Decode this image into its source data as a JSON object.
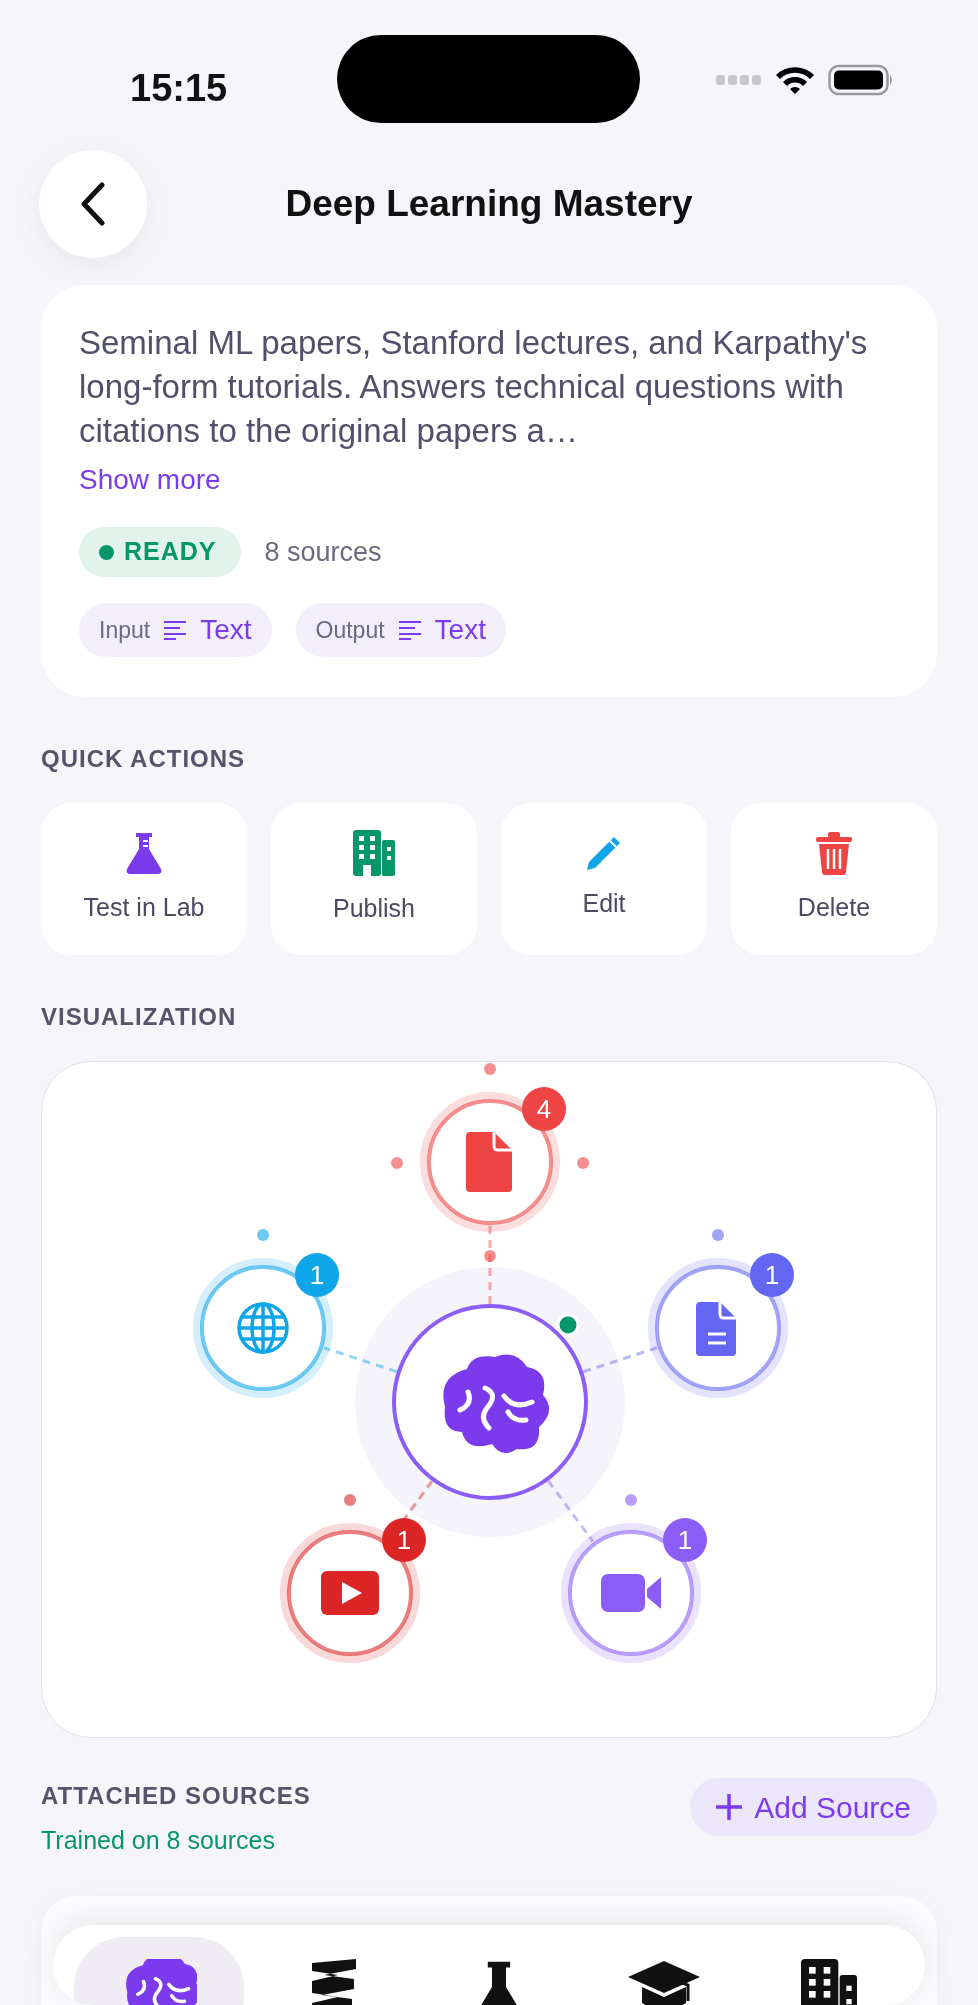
{
  "status_bar": {
    "time": "15:15"
  },
  "header": {
    "title": "Deep Learning Mastery"
  },
  "summary": {
    "description": "Seminal ML papers, Stanford lectures, and Karpathy's long-form tutorials. Answers technical questions with citations to the original papers a…",
    "show_more": "Show more",
    "status": {
      "label": "READY",
      "color": "#059669"
    },
    "source_count": "8 sources",
    "io": [
      {
        "label": "Input",
        "value": "Text"
      },
      {
        "label": "Output",
        "value": "Text"
      }
    ]
  },
  "quick_actions": {
    "title": "QUICK ACTIONS",
    "actions": [
      {
        "kind": "lab",
        "label": "Test in Lab",
        "color": "#7c3aed"
      },
      {
        "kind": "publish",
        "label": "Publish",
        "color": "#059669"
      },
      {
        "kind": "edit",
        "label": "Edit",
        "color": "#0ea5e9"
      },
      {
        "kind": "delete",
        "label": "Delete",
        "color": "#ef4444"
      }
    ]
  },
  "visualization": {
    "title": "VISUALIZATION",
    "nodes": [
      {
        "kind": "pdf",
        "count": "4",
        "color": "#ef4444"
      },
      {
        "kind": "web",
        "count": "1",
        "color": "#0ea5e9"
      },
      {
        "kind": "doc",
        "count": "1",
        "color": "#6366f1"
      },
      {
        "kind": "youtube",
        "count": "1",
        "color": "#dc2626"
      },
      {
        "kind": "video",
        "count": "1",
        "color": "#8b5cf6"
      }
    ]
  },
  "attached_sources": {
    "title": "ATTACHED SOURCES",
    "subtitle": "Trained on 8 sources",
    "add_button": "Add Source"
  },
  "tab_bar": [
    {
      "kind": "brain",
      "selected": true
    },
    {
      "kind": "layers",
      "selected": false
    },
    {
      "kind": "lab",
      "selected": false
    },
    {
      "kind": "academy",
      "selected": false
    },
    {
      "kind": "building",
      "selected": false
    }
  ]
}
